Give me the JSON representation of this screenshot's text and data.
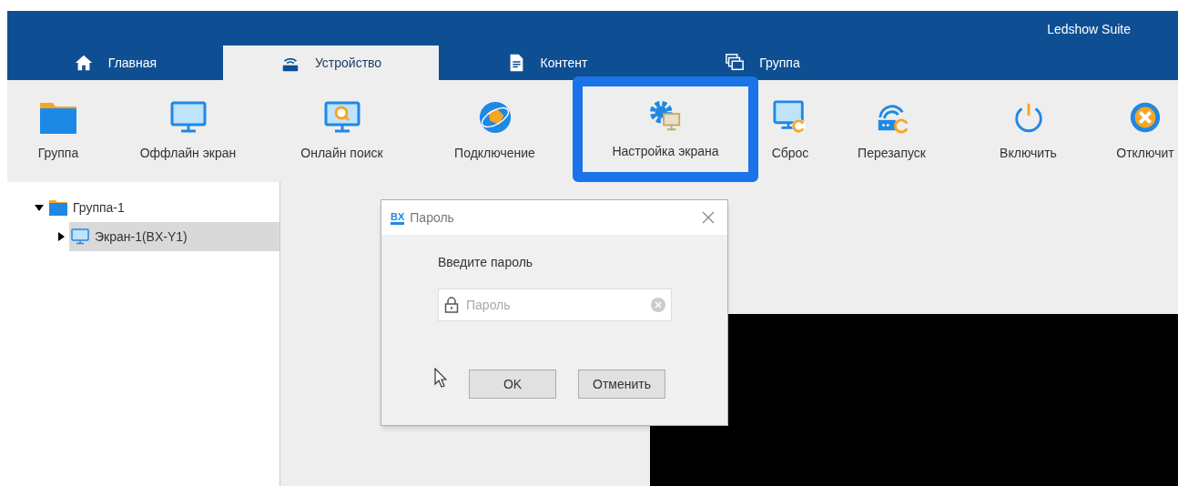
{
  "window": {
    "title": "Ledshow Suite"
  },
  "tabs": [
    {
      "label": "Главная",
      "selected": false
    },
    {
      "label": "Устройство",
      "selected": true
    },
    {
      "label": "Контент",
      "selected": false
    },
    {
      "label": "Группа",
      "selected": false
    }
  ],
  "toolbar": {
    "groups": [
      [
        {
          "label": "Группа",
          "highlighted": false
        }
      ],
      [
        {
          "label": "Оффлайн экран",
          "highlighted": false
        },
        {
          "label": "Онлайн поиск",
          "highlighted": false
        }
      ],
      [
        {
          "label": "Подключение",
          "highlighted": false
        },
        {
          "label": "Настройка экрана",
          "highlighted": true
        },
        {
          "label": "Сброс",
          "highlighted": false
        },
        {
          "label": "Перезапуск",
          "highlighted": false
        }
      ],
      [
        {
          "label": "Включить",
          "highlighted": false
        },
        {
          "label": "Отключит",
          "highlighted": false
        }
      ]
    ]
  },
  "tree": [
    {
      "label": "Группа-1",
      "expanded": true,
      "selected": false,
      "children": [
        {
          "label": "Экран-1(BX-Y1)",
          "expanded": false,
          "selected": true
        }
      ]
    }
  ],
  "dialog": {
    "logo_text": "BX",
    "title": "Пароль",
    "prompt": "Введите пароль",
    "password_field": {
      "placeholder": "Пароль"
    },
    "buttons": [
      {
        "label": "OK"
      },
      {
        "label": "Отменить"
      }
    ]
  }
}
